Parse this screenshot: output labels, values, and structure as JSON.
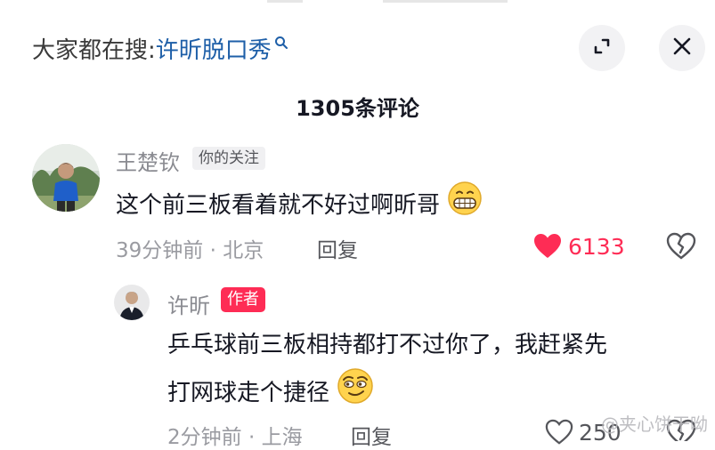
{
  "header": {
    "search_prefix": "大家都在搜:",
    "search_keyword": "许昕脱口秀"
  },
  "comments_title": "1305条评论",
  "comments": [
    {
      "username": "王楚钦",
      "tag": "你的关注",
      "text": "这个前三板看着就不好过啊昕哥",
      "time": "39分钟前 · 北京",
      "reply_label": "回复",
      "likes": "6133",
      "liked": true
    }
  ],
  "replies": [
    {
      "username": "许昕",
      "tag": "作者",
      "text_line1": "乒乓球前三板相持都打不过你了，我赶紧先",
      "text_line2": "打网球走个捷径",
      "time": "2分钟前 · 上海",
      "reply_label": "回复",
      "likes": "250",
      "liked": false
    }
  ],
  "watermark": "@夹心饼干呦",
  "colors": {
    "like_red": "#fe2c55",
    "keyword_blue": "#1e5fa8"
  }
}
